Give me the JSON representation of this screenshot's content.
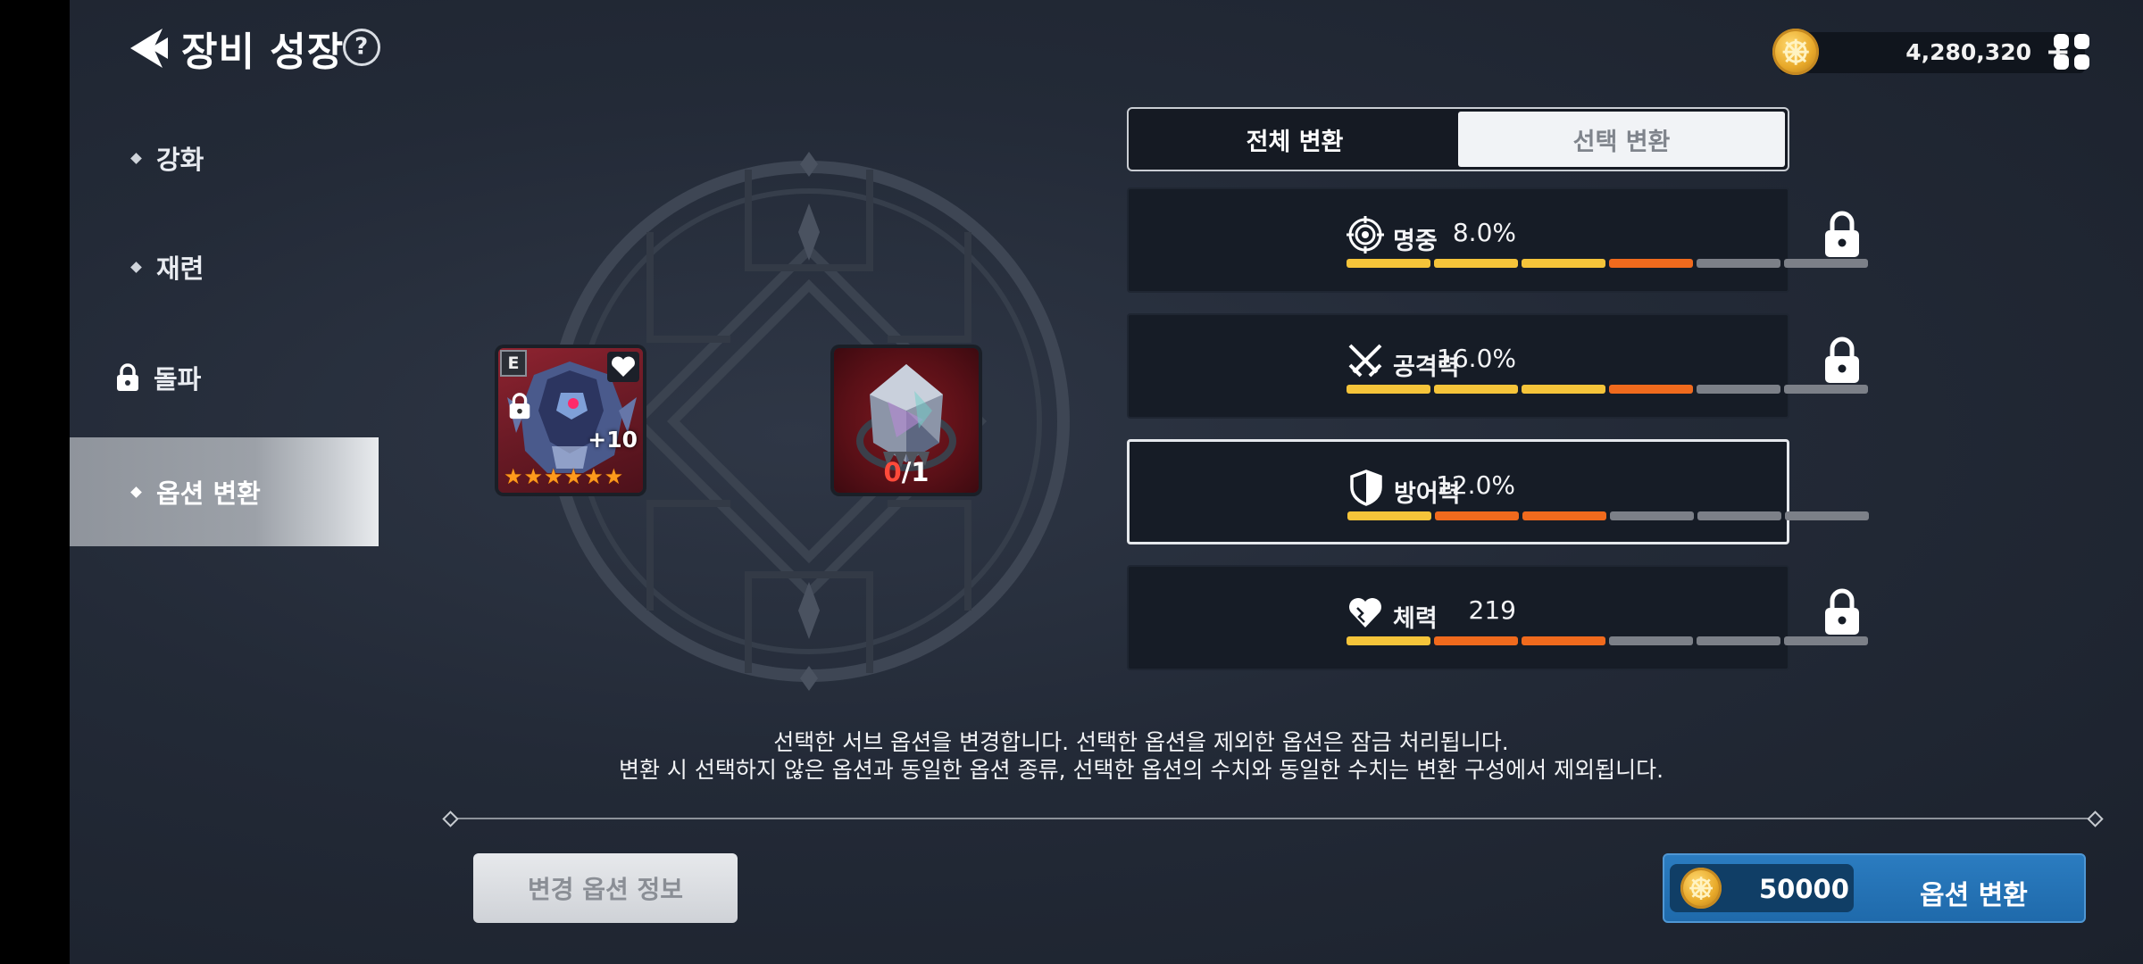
{
  "header": {
    "title": "장비 성장",
    "help_symbol": "?",
    "currency_amount": "4,280,320",
    "currency_plus": "+"
  },
  "sidebar": {
    "items": [
      {
        "label": "강화",
        "state": "normal"
      },
      {
        "label": "재련",
        "state": "normal"
      },
      {
        "label": "돌파",
        "state": "locked"
      },
      {
        "label": "옵션 변환",
        "state": "active"
      }
    ]
  },
  "item_slot": {
    "grade": "E",
    "level": "+10",
    "stars": 6
  },
  "material_slot": {
    "have": "0",
    "need": "/1"
  },
  "tabs": [
    {
      "label": "전체 변환",
      "selected": true
    },
    {
      "label": "선택 변환",
      "selected": false
    }
  ],
  "options": [
    {
      "icon": "target-icon",
      "name": "명중",
      "value": "8.0%",
      "locked": true,
      "bar": [
        "y",
        "y",
        "y",
        "o",
        "g",
        "g"
      ]
    },
    {
      "icon": "crossed-swords-icon",
      "name": "공격력",
      "value": "16.0%",
      "locked": true,
      "bar": [
        "y",
        "y",
        "y",
        "o",
        "g",
        "g"
      ]
    },
    {
      "icon": "shield-icon",
      "name": "방어력",
      "value": "12.0%",
      "locked": false,
      "bar": [
        "y",
        "o",
        "o",
        "g",
        "g",
        "g"
      ]
    },
    {
      "icon": "heart-icon",
      "name": "체력",
      "value": "219",
      "locked": true,
      "bar": [
        "y",
        "o",
        "o",
        "g",
        "g",
        "g"
      ]
    }
  ],
  "description": {
    "line1": "선택한 서브 옵션을 변경합니다. 선택한 옵션을 제외한 옵션은 잠금 처리됩니다.",
    "line2": "변환 시 선택하지 않은 옵션과 동일한 옵션 종류, 선택한 옵션의 수치와 동일한 수치는 변환 구성에서 제외됩니다."
  },
  "buttons": {
    "info_label": "변경 옵션 정보",
    "convert_cost": "50000",
    "convert_label": "옵션 변환"
  },
  "colors": {
    "bar_yellow": "#f5c43a",
    "bar_orange": "#f06a1d",
    "bar_gray": "#7c8088",
    "convert_blue": "#2274b6",
    "coin_gold": "#e8a929"
  }
}
